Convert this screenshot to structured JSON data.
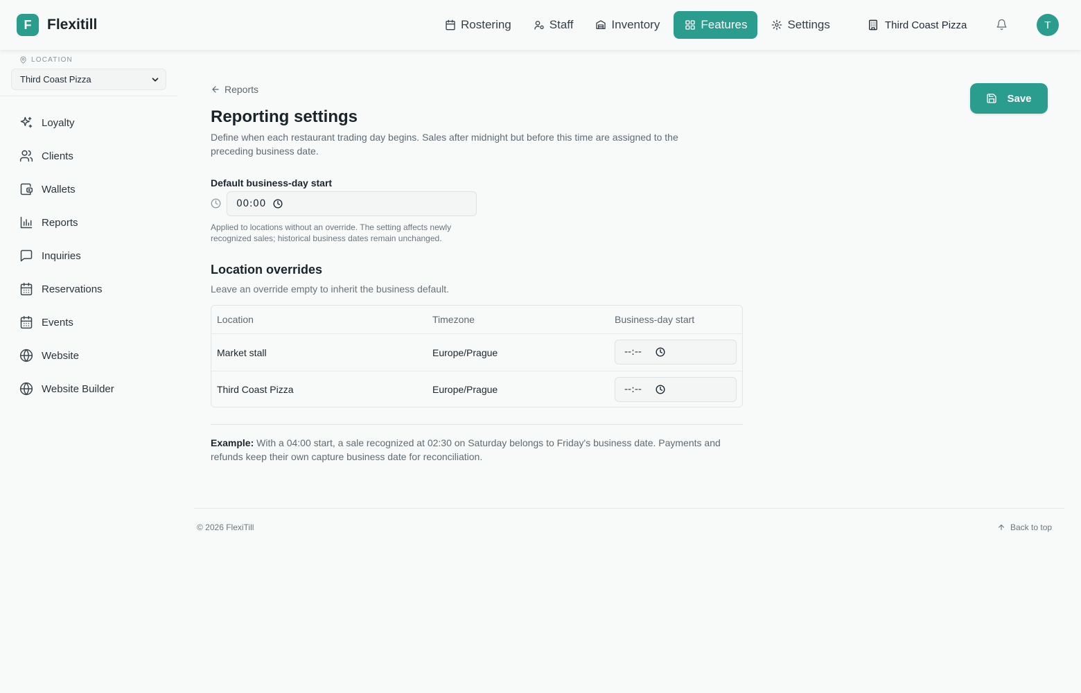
{
  "brand": {
    "logo_letter": "F",
    "name": "Flexitill"
  },
  "nav": {
    "items": [
      {
        "label": "Rostering",
        "icon": "calendar-icon"
      },
      {
        "label": "Staff",
        "icon": "staff-icon"
      },
      {
        "label": "Inventory",
        "icon": "inventory-icon"
      },
      {
        "label": "Features",
        "icon": "grid-icon",
        "active": true
      },
      {
        "label": "Settings",
        "icon": "gear-icon"
      }
    ],
    "tenant": "Third Coast Pizza",
    "avatar": "T"
  },
  "sidebar": {
    "location_label": "LOCATION",
    "location_value": "Third Coast Pizza",
    "items": [
      {
        "label": "Loyalty",
        "icon": "sparkles-icon"
      },
      {
        "label": "Clients",
        "icon": "users-icon"
      },
      {
        "label": "Wallets",
        "icon": "wallet-icon"
      },
      {
        "label": "Reports",
        "icon": "bar-chart-icon"
      },
      {
        "label": "Inquiries",
        "icon": "message-icon"
      },
      {
        "label": "Reservations",
        "icon": "calendar-icon"
      },
      {
        "label": "Events",
        "icon": "calendar-icon"
      },
      {
        "label": "Website",
        "icon": "globe-icon"
      },
      {
        "label": "Website Builder",
        "icon": "globe-icon"
      }
    ]
  },
  "main": {
    "back_label": "Reports",
    "title": "Reporting settings",
    "description": "Define when each restaurant trading day begins. Sales after midnight but before this time are assigned to the preceding business date.",
    "save_label": "Save",
    "default_start": {
      "label": "Default business-day start",
      "value": "00:00",
      "help": "Applied to locations without an override. The setting affects newly recognized sales; historical business dates remain unchanged."
    },
    "overrides": {
      "title": "Location overrides",
      "description": "Leave an override empty to inherit the business default.",
      "columns": [
        "Location",
        "Timezone",
        "Business-day start"
      ],
      "rows": [
        {
          "location": "Market stall",
          "timezone": "Europe/Prague",
          "start": "--:--"
        },
        {
          "location": "Third Coast Pizza",
          "timezone": "Europe/Prague",
          "start": "--:--"
        }
      ]
    },
    "example": {
      "label": "Example:",
      "text": "With a 04:00 start, a sale recognized at 02:30 on Saturday belongs to Friday's business date. Payments and refunds keep their own capture business date for reconciliation."
    }
  },
  "footer": {
    "copyright": "© 2026 FlexiTill",
    "back_to_top": "Back to top"
  },
  "colors": {
    "accent": "#2a9d8f",
    "background": "#f8f9f9",
    "text": "#1f2933",
    "muted": "#5f6b73"
  }
}
